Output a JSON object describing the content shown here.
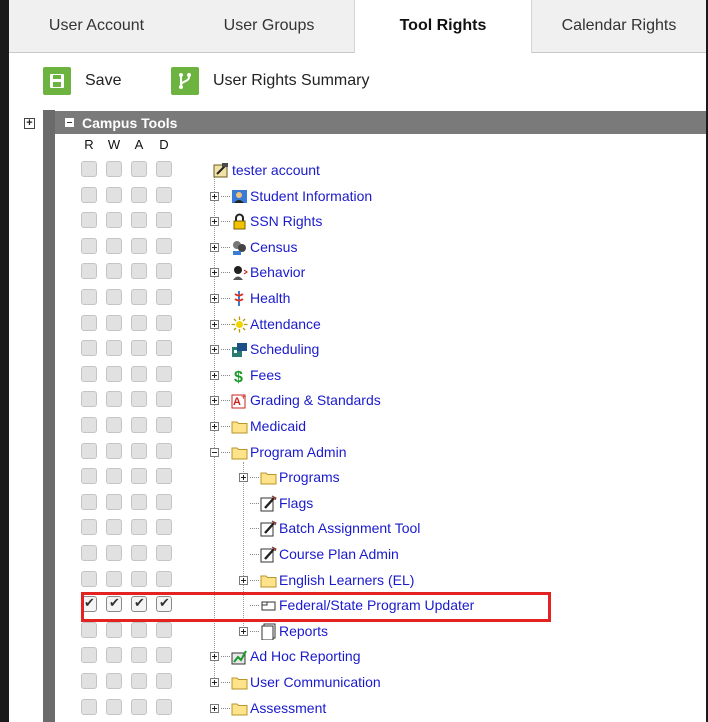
{
  "tabs": [
    {
      "label": "User Account"
    },
    {
      "label": "User Groups"
    },
    {
      "label": "Tool Rights",
      "active": true
    },
    {
      "label": "Calendar Rights"
    }
  ],
  "toolbar": {
    "save_label": "Save",
    "summary_label": "User Rights Summary"
  },
  "header": {
    "title": "Campus Tools",
    "columns": [
      "R",
      "W",
      "A",
      "D"
    ]
  },
  "tree": {
    "root": {
      "label": "tester account",
      "icon": "user-account-icon"
    },
    "items": [
      {
        "label": "Student Information",
        "icon": "student-icon"
      },
      {
        "label": "SSN Rights",
        "icon": "lock-icon"
      },
      {
        "label": "Census",
        "icon": "census-icon"
      },
      {
        "label": "Behavior",
        "icon": "behavior-icon"
      },
      {
        "label": "Health",
        "icon": "health-icon"
      },
      {
        "label": "Attendance",
        "icon": "attendance-icon"
      },
      {
        "label": "Scheduling",
        "icon": "scheduling-icon"
      },
      {
        "label": "Fees",
        "icon": "dollar-icon"
      },
      {
        "label": "Grading & Standards",
        "icon": "grading-icon"
      },
      {
        "label": "Medicaid",
        "icon": "folder-icon"
      },
      {
        "label": "Program Admin",
        "icon": "folder-icon"
      },
      {
        "label": "Programs",
        "icon": "folder-icon"
      },
      {
        "label": "Flags",
        "icon": "tool-icon"
      },
      {
        "label": "Batch Assignment Tool",
        "icon": "tool-icon"
      },
      {
        "label": "Course Plan Admin",
        "icon": "tool-icon"
      },
      {
        "label": "English Learners (EL)",
        "icon": "folder-icon"
      },
      {
        "label": "Federal/State Program Updater",
        "icon": "tab-icon",
        "checked": true
      },
      {
        "label": "Reports",
        "icon": "reports-icon"
      },
      {
        "label": "Ad Hoc Reporting",
        "icon": "adhoc-icon"
      },
      {
        "label": "User Communication",
        "icon": "folder-icon"
      },
      {
        "label": "Assessment",
        "icon": "folder-icon"
      }
    ]
  },
  "colors": {
    "accent_green": "#6db33f",
    "link_blue": "#1a1acc",
    "highlight_red": "#e32222",
    "header_gray": "#7a7a7a"
  }
}
